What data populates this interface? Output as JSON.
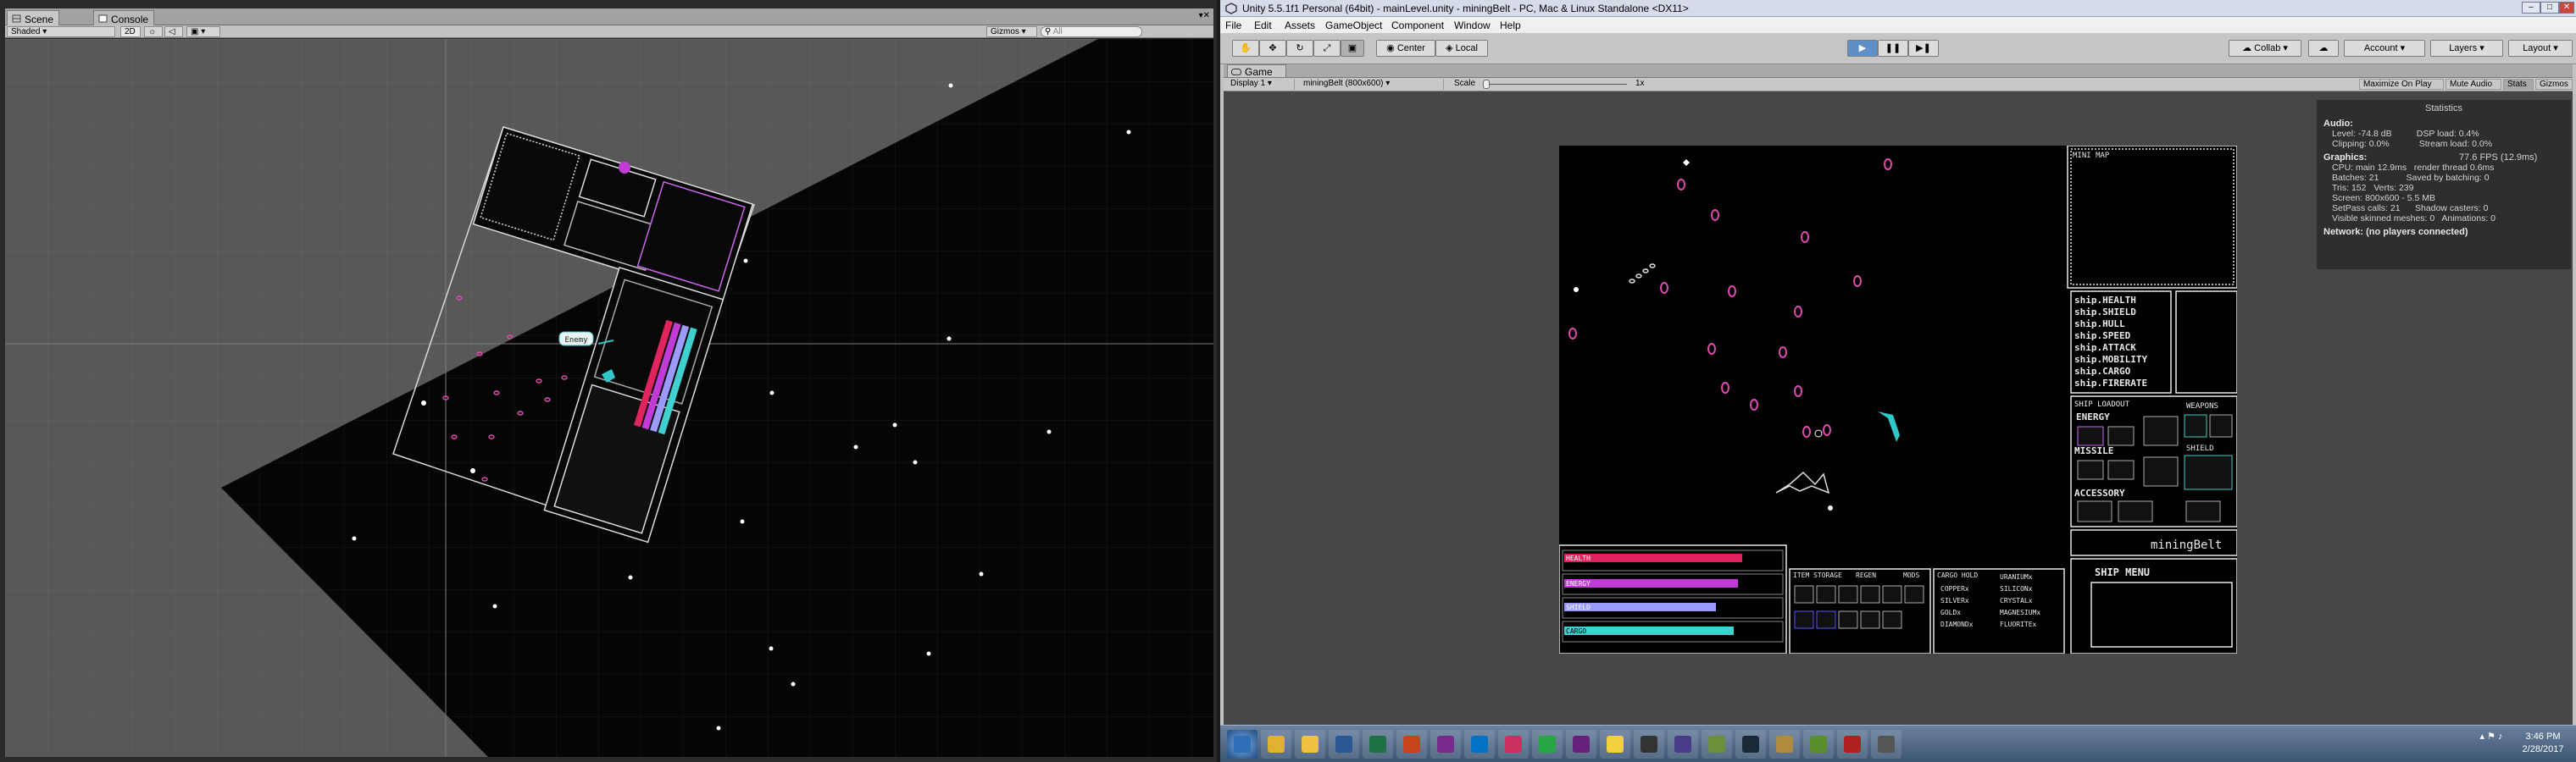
{
  "scene": {
    "tabs": [
      {
        "label": "Scene"
      },
      {
        "label": "Console"
      }
    ],
    "shading": "Shaded",
    "mode_2d": "2D",
    "gizmos": "Gizmos",
    "search_placeholder": "All",
    "bubble_label": "Enemy"
  },
  "editor": {
    "title": "Unity 5.5.1f1 Personal (64bit) - mainLevel.unity - miningBelt - PC, Mac & Linux Standalone <DX11>",
    "menu": [
      "File",
      "Edit",
      "Assets",
      "GameObject",
      "Component",
      "Window",
      "Help"
    ],
    "toolbar": {
      "pivot_center": "Center",
      "pivot_local": "Local",
      "collab": "Collab",
      "account": "Account",
      "layers": "Layers",
      "layout": "Layout"
    },
    "game": {
      "tab": "Game",
      "display": "Display 1",
      "resolution": "miningBelt (800x600)",
      "scale_label": "Scale",
      "scale_value": "1x",
      "maximize": "Maximize On Play",
      "mute": "Mute Audio",
      "stats": "Stats",
      "gizmos": "Gizmos"
    },
    "statistics": {
      "heading": "Statistics",
      "audio_label": "Audio:",
      "audio": [
        "Level: -74.8 dB          DSP load: 0.4%",
        "Clipping: 0.0%            Stream load: 0.0%"
      ],
      "graphics_label": "Graphics:",
      "fps": "77.6 FPS (12.9ms)",
      "graphics": [
        "CPU: main 12.9ms   render thread 0.6ms",
        "Batches: 21           Saved by batching: 0",
        "Tris: 152   Verts: 239",
        "Screen: 800x600 - 5.5 MB",
        "SetPass calls: 21      Shadow casters: 0",
        "Visible skinned meshes: 0   Animations: 0"
      ],
      "network": "Network: (no players connected)"
    }
  },
  "hud": {
    "minimap": "MINI MAP",
    "ship_stats": [
      "ship.HEALTH",
      "ship.SHIELD",
      "ship.HULL",
      "ship.SPEED",
      "ship.ATTACK",
      "ship.MOBILITY",
      "ship.CARGO",
      "ship.FIRERATE"
    ],
    "loadout": "SHIP LOADOUT",
    "weapons": "WEAPONS",
    "shield": "SHIELD",
    "energy": "ENERGY",
    "missile": "MISSILE",
    "accessory": "ACCESSORY",
    "game_title": "miningBelt",
    "ship_menu": "SHIP MENU",
    "bars": [
      {
        "label": "HEALTH",
        "color": "#e0245e",
        "fill": 0.82
      },
      {
        "label": "ENERGY",
        "color": "#c23bd6",
        "fill": 0.8
      },
      {
        "label": "SHIELD",
        "color": "#9a9aff",
        "fill": 0.7
      },
      {
        "label": "CARGO",
        "color": "#3fd0d0",
        "fill": 0.78
      }
    ],
    "storage_label": "ITEM STORAGE",
    "regen_label": "REGEN",
    "mods_label": "MODS",
    "cargo_hold": "CARGO HOLD",
    "ores": [
      "COPPERx",
      "SILVERx",
      "GOLDx",
      "DIAMONDx"
    ],
    "ores2": [
      "URANIUMx",
      "SILICONx",
      "CRYSTALx",
      "MAGNESIUMx",
      "FLUORITEx"
    ]
  },
  "taskbar": {
    "time": "3:46 PM",
    "date": "2/28/2017",
    "apps": [
      "start-icon",
      "chrome-icon",
      "explorer-icon",
      "word-icon",
      "excel-icon",
      "powerpoint-icon",
      "onenote-icon",
      "outlook-icon",
      "intellij-icon",
      "pycharm-icon",
      "visualstudio-icon",
      "mascot-icon",
      "unity-icon",
      "alienware-icon",
      "gimp-icon",
      "steam-icon",
      "league-icon",
      "minecraft-icon",
      "flash-icon",
      "unity-editor-icon"
    ]
  }
}
